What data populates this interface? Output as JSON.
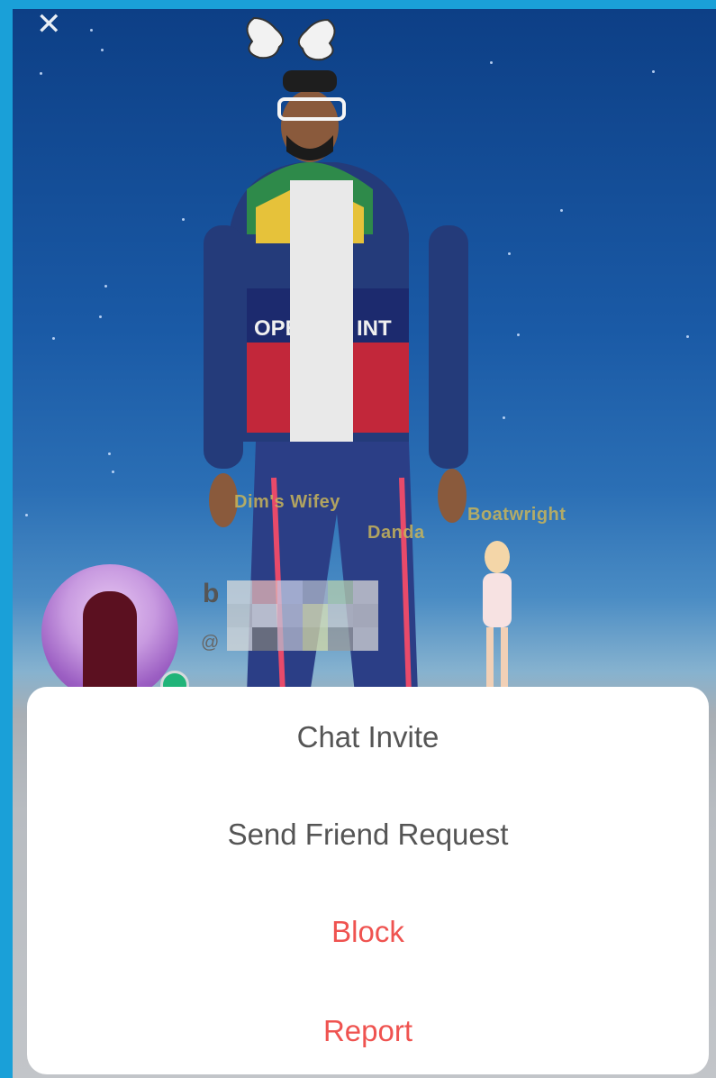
{
  "close_icon": "close-icon",
  "scene": {
    "name_tags": [
      "Dim's Wifey",
      "Danda",
      "Boatwright"
    ]
  },
  "profile": {
    "initial": "b",
    "handle_prefix": "@",
    "online": true
  },
  "action_sheet": {
    "items": [
      {
        "label": "Chat Invite",
        "style": "neutral",
        "color": "#555555"
      },
      {
        "label": "Send Friend Request",
        "style": "neutral",
        "color": "#555555"
      },
      {
        "label": "Block",
        "style": "danger",
        "color": "#ef5350"
      },
      {
        "label": "Report",
        "style": "danger",
        "color": "#ef5350"
      }
    ]
  },
  "colors": {
    "frame_border": "#1aa0d8",
    "online_dot": "#21b479",
    "danger": "#ef5350"
  }
}
